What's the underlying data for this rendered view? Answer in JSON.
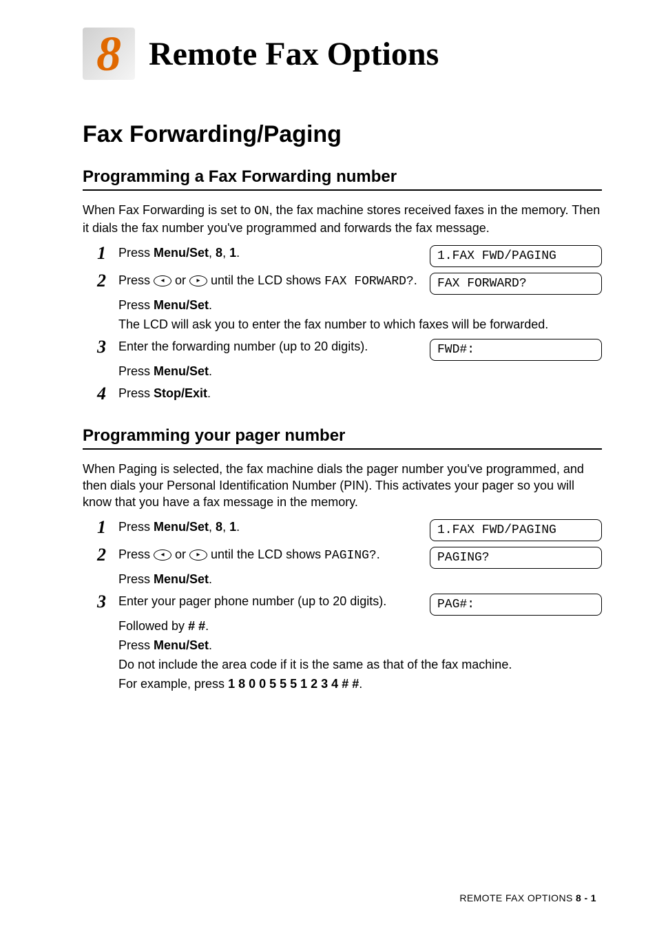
{
  "chapter": {
    "number": "8",
    "title": "Remote Fax Options"
  },
  "section_title": "Fax Forwarding/Paging",
  "sub1": {
    "title": "Programming a Fax Forwarding number",
    "intro_a": "When Fax Forwarding is set to ",
    "intro_on": "ON",
    "intro_b": ", the fax machine stores received faxes in the memory. Then it dials the fax number you've programmed and forwards the fax message.",
    "step1_a": "Press ",
    "step1_b": "Menu/Set",
    "step1_c": ", ",
    "step1_d": "8",
    "step1_e": ", ",
    "step1_f": "1",
    "step1_g": ".",
    "lcd1": "1.FAX FWD/PAGING",
    "step2_a": "Press ",
    "step2_b": " or ",
    "step2_c": " until the LCD shows ",
    "step2_d": "FAX FORWARD?",
    "step2_e": ".",
    "lcd2": "FAX FORWARD?",
    "step2_f": "Press ",
    "step2_g": "Menu/Set",
    "step2_h": ".",
    "step2_i": "The LCD will ask you to enter the fax number to which faxes will be forwarded.",
    "step3_a": "Enter the forwarding number (up to 20 digits).",
    "lcd3": "FWD#:",
    "step3_b": "Press ",
    "step3_c": "Menu/Set",
    "step3_d": ".",
    "step4_a": "Press ",
    "step4_b": "Stop/Exit",
    "step4_c": "."
  },
  "sub2": {
    "title": "Programming your pager number",
    "intro": "When Paging is selected, the fax machine dials the pager number you've programmed, and then dials your Personal Identification Number (PIN). This activates your pager so you will know that you have a fax message in the memory.",
    "step1_a": "Press ",
    "step1_b": "Menu/Set",
    "step1_c": ", ",
    "step1_d": "8",
    "step1_e": ", ",
    "step1_f": "1",
    "step1_g": ".",
    "lcd1": "1.FAX FWD/PAGING",
    "step2_a": "Press ",
    "step2_b": " or ",
    "step2_c": " until the LCD shows ",
    "step2_d": "PAGING?",
    "step2_e": ".",
    "lcd2": "PAGING?",
    "step2_f": "Press ",
    "step2_g": "Menu/Set",
    "step2_h": ".",
    "step3_a": "Enter your pager phone number (up to 20 digits).",
    "lcd3": "PAG#:",
    "step3_b": "Followed by ",
    "step3_c": "# #",
    "step3_d": ".",
    "step3_e": "Press ",
    "step3_f": "Menu/Set",
    "step3_g": ".",
    "step3_h": "Do not include the area code if it is the same as that of the fax machine.",
    "step3_i": "For example, press ",
    "step3_j": "1 8 0 0 5 5 5 1 2 3 4 # #",
    "step3_k": "."
  },
  "footer": {
    "label": "REMOTE FAX OPTIONS   ",
    "page": "8 - 1"
  }
}
